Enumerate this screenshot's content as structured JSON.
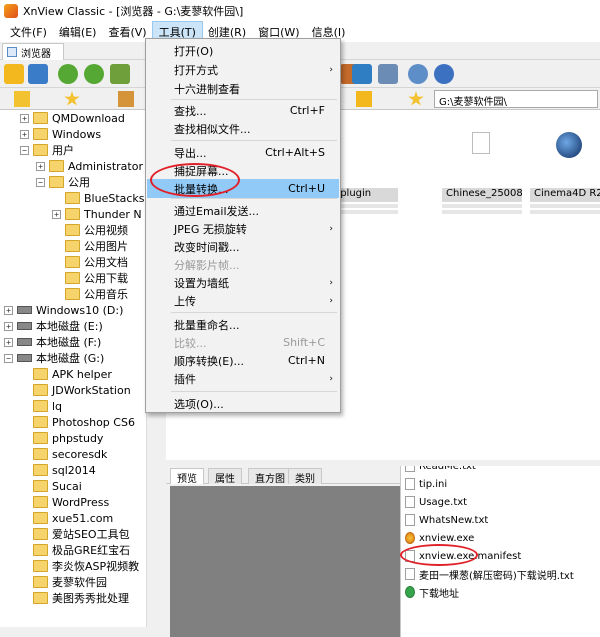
{
  "window": {
    "title": "XnView Classic - [浏览器 - G:\\麦蓼软件园\\]"
  },
  "menubar": [
    "文件(F)",
    "编辑(E)",
    "查看(V)",
    "工具(T)",
    "创建(R)",
    "窗口(W)",
    "信息(I)"
  ],
  "browser_tab": "浏览器",
  "address": "G:\\麦蓼软件园\\",
  "tools_menu": {
    "items": [
      {
        "label": "打开(O)",
        "shortcut": "",
        "submenu": false,
        "disabled": false
      },
      {
        "label": "打开方式",
        "shortcut": "",
        "submenu": true,
        "disabled": false
      },
      {
        "label": "十六进制查看",
        "shortcut": "",
        "submenu": false,
        "disabled": false
      },
      {
        "label": "查找...",
        "shortcut": "Ctrl+F",
        "submenu": false,
        "disabled": false
      },
      {
        "label": "查找相似文件...",
        "shortcut": "",
        "submenu": false,
        "disabled": false
      },
      {
        "label": "导出...",
        "shortcut": "Ctrl+Alt+S",
        "submenu": false,
        "disabled": false
      },
      {
        "label": "捕捉屏幕...",
        "shortcut": "",
        "submenu": false,
        "disabled": false
      },
      {
        "label": "批量转换...",
        "shortcut": "Ctrl+U",
        "submenu": false,
        "disabled": false,
        "highlighted": true
      },
      {
        "label": "通过Email发送...",
        "shortcut": "",
        "submenu": false,
        "disabled": false
      },
      {
        "label": "JPEG 无损旋转",
        "shortcut": "",
        "submenu": true,
        "disabled": false
      },
      {
        "label": "改变时间戳...",
        "shortcut": "",
        "submenu": false,
        "disabled": false
      },
      {
        "label": "分解影片帧...",
        "shortcut": "",
        "submenu": false,
        "disabled": true
      },
      {
        "label": "设置为墙纸",
        "shortcut": "",
        "submenu": true,
        "disabled": false
      },
      {
        "label": "上传",
        "shortcut": "",
        "submenu": true,
        "disabled": false
      },
      {
        "label": "批量重命名...",
        "shortcut": "",
        "submenu": false,
        "disabled": false
      },
      {
        "label": "比较...",
        "shortcut": "Shift+C",
        "submenu": false,
        "disabled": true
      },
      {
        "label": "顺序转换(E)...",
        "shortcut": "Ctrl+N",
        "submenu": false,
        "disabled": false
      },
      {
        "label": "插件",
        "shortcut": "",
        "submenu": true,
        "disabled": false
      },
      {
        "label": "选项(O)...",
        "shortcut": "",
        "submenu": false,
        "disabled": false
      }
    ]
  },
  "tree": [
    {
      "label": "QMDownload",
      "type": "folder",
      "exp": "+",
      "indent": 1
    },
    {
      "label": "Windows",
      "type": "folder",
      "exp": "+",
      "indent": 1
    },
    {
      "label": "用户",
      "type": "folder",
      "exp": "−",
      "indent": 1
    },
    {
      "label": "Administrator",
      "type": "folder",
      "exp": "+",
      "indent": 2
    },
    {
      "label": "公用",
      "type": "folder",
      "exp": "−",
      "indent": 2
    },
    {
      "label": "BlueStacks",
      "type": "folder",
      "exp": "",
      "indent": 3
    },
    {
      "label": "Thunder N",
      "type": "folder",
      "exp": "+",
      "indent": 3
    },
    {
      "label": "公用视频",
      "type": "folder",
      "exp": "",
      "indent": 3
    },
    {
      "label": "公用图片",
      "type": "folder",
      "exp": "",
      "indent": 3
    },
    {
      "label": "公用文档",
      "type": "folder",
      "exp": "",
      "indent": 3
    },
    {
      "label": "公用下载",
      "type": "folder",
      "exp": "",
      "indent": 3
    },
    {
      "label": "公用音乐",
      "type": "folder",
      "exp": "",
      "indent": 3
    },
    {
      "label": "Windows10 (D:)",
      "type": "drive",
      "exp": "+",
      "indent": 0
    },
    {
      "label": "本地磁盘 (E:)",
      "type": "drive",
      "exp": "+",
      "indent": 0
    },
    {
      "label": "本地磁盘 (F:)",
      "type": "drive",
      "exp": "+",
      "indent": 0
    },
    {
      "label": "本地磁盘 (G:)",
      "type": "drive",
      "exp": "−",
      "indent": 0
    },
    {
      "label": "APK helper",
      "type": "folder",
      "exp": "",
      "indent": 1
    },
    {
      "label": "JDWorkStation",
      "type": "folder",
      "exp": "",
      "indent": 1
    },
    {
      "label": "lq",
      "type": "folder",
      "exp": "",
      "indent": 1
    },
    {
      "label": "Photoshop CS6",
      "type": "folder",
      "exp": "",
      "indent": 1
    },
    {
      "label": "phpstudy",
      "type": "folder",
      "exp": "",
      "indent": 1
    },
    {
      "label": "secoresdk",
      "type": "folder",
      "exp": "",
      "indent": 1
    },
    {
      "label": "sql2014",
      "type": "folder",
      "exp": "",
      "indent": 1
    },
    {
      "label": "Sucai",
      "type": "folder",
      "exp": "",
      "indent": 1
    },
    {
      "label": "WordPress",
      "type": "folder",
      "exp": "",
      "indent": 1
    },
    {
      "label": "xue51.com",
      "type": "folder",
      "exp": "",
      "indent": 1
    },
    {
      "label": "爱站SEO工具包",
      "type": "folder",
      "exp": "",
      "indent": 1
    },
    {
      "label": "极品GRE红宝石",
      "type": "folder",
      "exp": "",
      "indent": 1
    },
    {
      "label": "李炎恢ASP视频教",
      "type": "folder",
      "exp": "",
      "indent": 1
    },
    {
      "label": "麦蓼软件园",
      "type": "folder",
      "exp": "",
      "indent": 1
    },
    {
      "label": "美图秀秀批处理",
      "type": "folder",
      "exp": "",
      "indent": 1
    }
  ],
  "thumbnails": [
    "c4dplugin",
    "Chinese_25008...",
    "Cinema4D R2"
  ],
  "bottom_tabs": [
    "预览",
    "属性",
    "直方图",
    "类别"
  ],
  "files": [
    {
      "name": "ReadMe.txt",
      "icon": "file-icon"
    },
    {
      "name": "tip.ini",
      "icon": "file-icon"
    },
    {
      "name": "Usage.txt",
      "icon": "file-icon"
    },
    {
      "name": "WhatsNew.txt",
      "icon": "file-icon"
    },
    {
      "name": "xnview.exe",
      "icon": "exe-icon"
    },
    {
      "name": "xnview.exe.manifest",
      "icon": "file-icon"
    },
    {
      "name": "麦田一棵葱(解压密码)下载说明.txt",
      "icon": "file-icon"
    },
    {
      "name": "下载地址",
      "icon": "link-icon"
    }
  ]
}
